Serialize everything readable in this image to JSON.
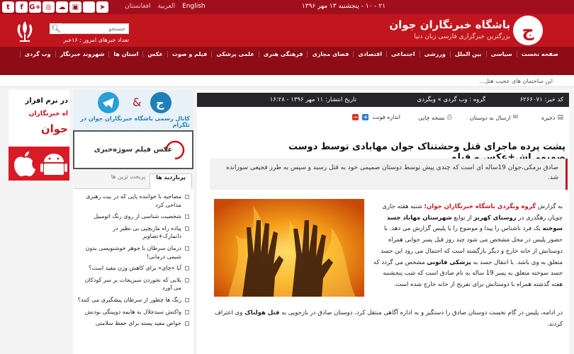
{
  "topbar": {
    "date": "۲۱ - ۱۰ - پنجشنبه ۱۳ مهر ۱۳۹۶",
    "languages": [
      "English",
      "العربية",
      "افغانستان"
    ],
    "social_icons": [
      "twitter-icon",
      "facebook-icon",
      "google-plus-icon",
      "instagram-icon",
      "soundcloud-icon",
      "android-icon",
      "apple-icon",
      "telegram-icon"
    ]
  },
  "header": {
    "title": "باشگاه خبرنگاران جوان",
    "subtitle": "بزرگترین خبرگزاری فارسی زبان دنیا",
    "search_placeholder": "جستجو",
    "today_count": "تعداد خبرهای امروز : ۱۶خبر",
    "brand_color": "#c2161f"
  },
  "nav": {
    "items": [
      "صفحه نخست",
      "سیاسی",
      "بین الملل",
      "ورزشی",
      "اجتماعی",
      "اقتصادی",
      "فضای مجازی",
      "فرهنگی هنری",
      "علمی پزشکی",
      "فیلم و صوت",
      "عکس",
      "استان ها",
      "شهروند خبرنگار",
      "وب گردی"
    ]
  },
  "ticker": {
    "text": "این ساختمان های عجیب هتل..."
  },
  "article": {
    "news_code": "کد خبر: ۶۲۶۶۰۷۱",
    "group": "گروه : وب گردی » وبگردی",
    "publish_date": "تاریخ انتشار: ۱۱ مهر ۱۳۹۶ - ۱۶:۲۸",
    "tools": {
      "save": "ذخیره",
      "send": "ارسال به دوستان",
      "print": "نسخه چاپی",
      "font_size": "اندازه فونت"
    },
    "headline": "پشت پرده ماجرای قتل وحشتناک جوان مهابادی توسط دوست صمیمی‌اش+عکس و فیلم",
    "lead": "صادق برمکی،جوان 19ساله ای است که چندی پیش توسط دوستان صمیمی خود به قتل رسید و سپس به طرز فجیعی سوزانده شد.",
    "photo_alt": "hands-on-fire-image",
    "p1_prefix": "به گزارش",
    "p1_link": "گروه وبگردی باشگاه خبرنگاران جوان؛",
    "p1_a": "شنبه هفته جاری چوپان رهگذری در",
    "p1_place": "روستای کهریز",
    "p1_b": "از توابع",
    "p1_city": "شهرستان مهاباد جسد سوخته",
    "p1_c": "یک فرد ناشناس را پیدا و موضوع را با پلیس گزارش می دهد. با حضور پلیس در محل مشخص می شود چند روز قبل پسر جوانی همراه دوستانش از خانه خارج و دیگر بازگشته است که احتمال می رود این جسد متعلق به وی باشد. با انتقال جسد به",
    "p1_forensic": "پزشکی قانونی",
    "p1_d": "مشخص می گردد که جسد سوخته متعلق به پسر 19 ساله به نام صادق است که شب پنجشنبه هفته گذشته همراه با دوستانش برای تفریح از خانه خارج شده است.",
    "p2_a": "در ادامه، پلیس در گام نخست دوستان صادق را دستگیر و به اداره آگاهی منتقل کرد، دوستان صادق در بازجویی به",
    "p2_bold": "قتل هولناک",
    "p2_b": "وی اعتراف کردند."
  },
  "sidebar": {
    "promo_text": "کانال رسمی باشگاه خبرنگاران جوان در تلگرام",
    "banner_text": "عکس فیلم سوژه‌خبری",
    "tabs": [
      "پربازدید ها",
      "پربحث ترین ها"
    ],
    "most_viewed": [
      "مصاحبه با خواننده پاپی که در بیت رهبری مداحی کرد",
      "شخصیت شناسی از روی رنگ اتومبیل",
      "پیاده راه ماریچپی بی نظیر در دانمارک+تصاویر",
      "درمان سرطان با جوهر خوشنویسی بدون شیمی درمانی!",
      "آیا «چای» برای کاهش وزن مفید است؟",
      "بلایی که نخوردن سبزیجات بر سر کودکان می آورد",
      "رنگ ها چطور از سرطان پیشگیری می کنند؟",
      "واکنش سیدجلال به هایمه دوپینگی بودنش",
      "خواص مفید پسته برای حفظ سلامتی"
    ],
    "app_ad": {
      "line1": "در نرم افزار",
      "line2": "اه خبرنگاران",
      "line3": "جوان"
    }
  }
}
